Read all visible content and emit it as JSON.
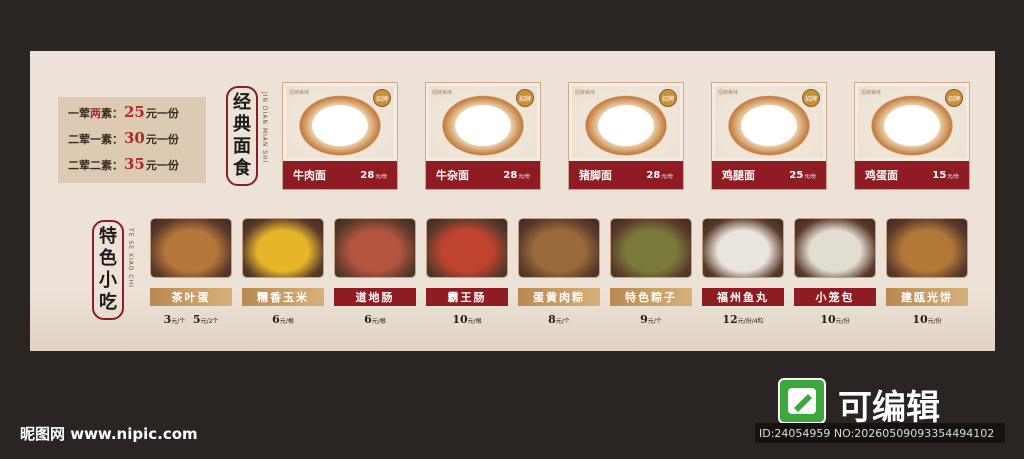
{
  "price_list": [
    {
      "pre": "一荤",
      "red": "两",
      "post": "素：",
      "num": "25",
      "suffix": "元一份"
    },
    {
      "pre": "二荤一素：",
      "red": "",
      "post": "",
      "num": "30",
      "suffix": "元一份"
    },
    {
      "pre": "二荤二素：",
      "red": "",
      "post": "",
      "num": "35",
      "suffix": "元一份"
    }
  ],
  "noodle_section": {
    "title": [
      "经",
      "典",
      "面",
      "食"
    ],
    "pinyin": "JIN DIAN MIAN SHI"
  },
  "snack_section": {
    "title": [
      "特",
      "色",
      "小",
      "吃"
    ],
    "pinyin": "TE SE XIAO CHI"
  },
  "noodles": [
    {
      "name": "牛肉面",
      "price": "28",
      "unit": "元/份",
      "seal": "招牌",
      "tag": "招牌美味"
    },
    {
      "name": "牛杂面",
      "price": "28",
      "unit": "元/份",
      "seal": "招牌",
      "tag": "招牌美味"
    },
    {
      "name": "猪脚面",
      "price": "28",
      "unit": "元/份",
      "seal": "招牌",
      "tag": "招牌美味"
    },
    {
      "name": "鸡腿面",
      "price": "25",
      "unit": "元/份",
      "seal": "招牌",
      "tag": "招牌美味"
    },
    {
      "name": "鸡蛋面",
      "price": "15",
      "unit": "元/份",
      "seal": "招牌",
      "tag": "招牌美味"
    }
  ],
  "snacks": [
    {
      "name": "茶叶蛋",
      "style": "gold",
      "prices": [
        {
          "v": "3",
          "u": "元/个"
        },
        {
          "v": "5",
          "u": "元/2个"
        }
      ],
      "color": "#b8773a"
    },
    {
      "name": "糯香玉米",
      "style": "gold",
      "prices": [
        {
          "v": "6",
          "u": "元/根"
        }
      ],
      "color": "#e6b52a"
    },
    {
      "name": "道地肠",
      "style": "red",
      "prices": [
        {
          "v": "6",
          "u": "元/根"
        }
      ],
      "color": "#b2543e"
    },
    {
      "name": "霸王肠",
      "style": "red",
      "prices": [
        {
          "v": "10",
          "u": "元/根"
        }
      ],
      "color": "#c0432e"
    },
    {
      "name": "蛋黄肉粽",
      "style": "gold",
      "prices": [
        {
          "v": "8",
          "u": "元/个"
        }
      ],
      "color": "#9a6a3a"
    },
    {
      "name": "特色粽子",
      "style": "gold",
      "prices": [
        {
          "v": "9",
          "u": "元/个"
        }
      ],
      "color": "#7a7a3a"
    },
    {
      "name": "福州鱼丸",
      "style": "red",
      "prices": [
        {
          "v": "12",
          "u": "元/份/4粒"
        }
      ],
      "color": "#e9e4dc"
    },
    {
      "name": "小笼包",
      "style": "red",
      "prices": [
        {
          "v": "10",
          "u": "元/份"
        }
      ],
      "color": "#e2ddd2"
    },
    {
      "name": "建瓯光饼",
      "style": "gold",
      "prices": [
        {
          "v": "10",
          "u": "元/份"
        }
      ],
      "color": "#b27838"
    }
  ],
  "footer": {
    "site": "昵图网 www.nipic.com",
    "brand": "可编辑",
    "id_line": "ID:24054959 NO:20260509093354494102"
  },
  "colors": {
    "accent_red": "#8e1c22",
    "gold": "#c8a06a",
    "board": "#ece2d7",
    "frame": "#2a2422"
  }
}
